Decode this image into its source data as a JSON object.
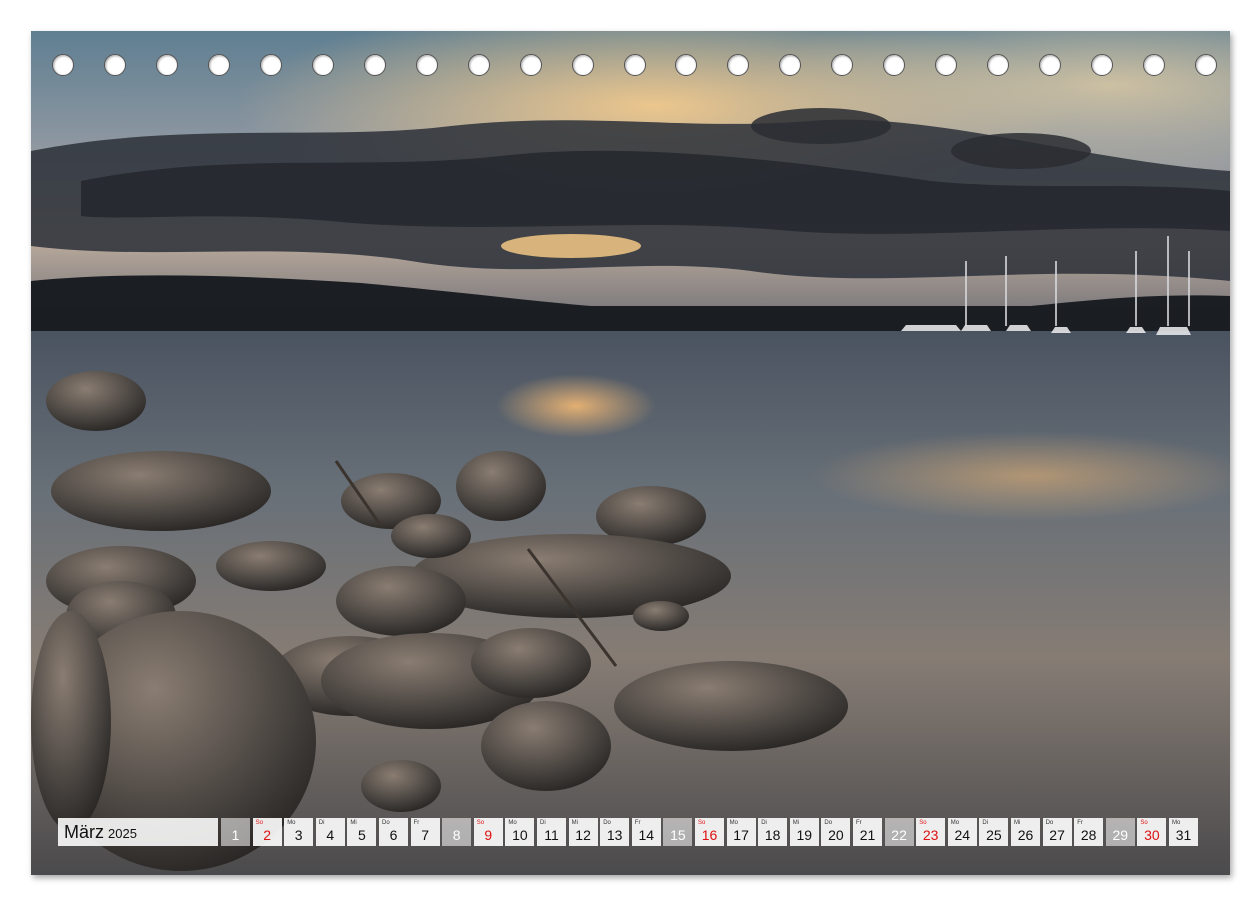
{
  "calendar": {
    "month": "März",
    "year": "2025",
    "days": [
      {
        "n": "1",
        "wd": "",
        "type": "muted"
      },
      {
        "n": "2",
        "wd": "So",
        "type": "red"
      },
      {
        "n": "3",
        "wd": "Mo",
        "type": "normal"
      },
      {
        "n": "4",
        "wd": "Di",
        "type": "normal"
      },
      {
        "n": "5",
        "wd": "Mi",
        "type": "normal"
      },
      {
        "n": "6",
        "wd": "Do",
        "type": "normal"
      },
      {
        "n": "7",
        "wd": "Fr",
        "type": "normal"
      },
      {
        "n": "8",
        "wd": "",
        "type": "muted"
      },
      {
        "n": "9",
        "wd": "So",
        "type": "red"
      },
      {
        "n": "10",
        "wd": "Mo",
        "type": "normal"
      },
      {
        "n": "11",
        "wd": "Di",
        "type": "normal"
      },
      {
        "n": "12",
        "wd": "Mi",
        "type": "normal"
      },
      {
        "n": "13",
        "wd": "Do",
        "type": "normal"
      },
      {
        "n": "14",
        "wd": "Fr",
        "type": "normal"
      },
      {
        "n": "15",
        "wd": "",
        "type": "muted"
      },
      {
        "n": "16",
        "wd": "So",
        "type": "red"
      },
      {
        "n": "17",
        "wd": "Mo",
        "type": "normal"
      },
      {
        "n": "18",
        "wd": "Di",
        "type": "normal"
      },
      {
        "n": "19",
        "wd": "Mi",
        "type": "normal"
      },
      {
        "n": "20",
        "wd": "Do",
        "type": "normal"
      },
      {
        "n": "21",
        "wd": "Fr",
        "type": "normal"
      },
      {
        "n": "22",
        "wd": "",
        "type": "muted"
      },
      {
        "n": "23",
        "wd": "So",
        "type": "red"
      },
      {
        "n": "24",
        "wd": "Mo",
        "type": "normal"
      },
      {
        "n": "25",
        "wd": "Di",
        "type": "normal"
      },
      {
        "n": "26",
        "wd": "Mi",
        "type": "normal"
      },
      {
        "n": "27",
        "wd": "Do",
        "type": "normal"
      },
      {
        "n": "28",
        "wd": "Fr",
        "type": "normal"
      },
      {
        "n": "29",
        "wd": "",
        "type": "muted"
      },
      {
        "n": "30",
        "wd": "So",
        "type": "red"
      },
      {
        "n": "31",
        "wd": "Mo",
        "type": "normal"
      }
    ]
  },
  "binding": {
    "hole_count": 23
  },
  "colors": {
    "sunday": "#dd1111",
    "hole_fill": "#ffffff"
  }
}
